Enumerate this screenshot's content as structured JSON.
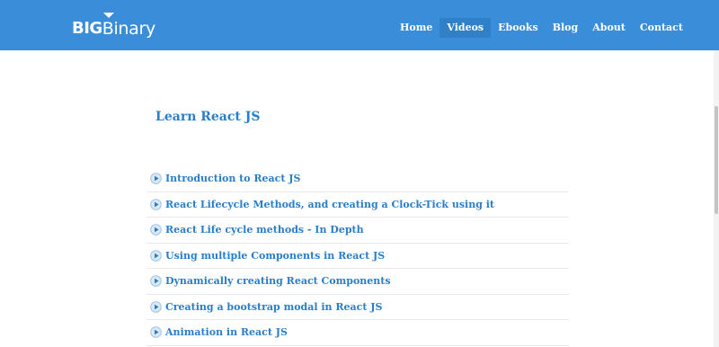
{
  "header": {
    "logo": {
      "big": "BIG",
      "binary": "Binary"
    },
    "nav": [
      {
        "label": "Home",
        "active": false
      },
      {
        "label": "Videos",
        "active": true
      },
      {
        "label": "Ebooks",
        "active": false
      },
      {
        "label": "Blog",
        "active": false
      },
      {
        "label": "About",
        "active": false
      },
      {
        "label": "Contact",
        "active": false
      }
    ]
  },
  "main": {
    "title": "Learn React JS",
    "videos": [
      {
        "title": "Introduction to React JS",
        "icon": "play-circle-icon"
      },
      {
        "title": "React Lifecycle Methods, and creating a Clock-Tick using it",
        "icon": "play-circle-icon"
      },
      {
        "title": "React Life cycle methods - In Depth",
        "icon": "play-circle-icon"
      },
      {
        "title": "Using multiple Components in React JS",
        "icon": "play-circle-icon"
      },
      {
        "title": "Dynamically creating React Components",
        "icon": "play-circle-icon"
      },
      {
        "title": "Creating a bootstrap modal in React JS",
        "icon": "play-circle-icon"
      },
      {
        "title": "Animation in React JS",
        "icon": "play-circle-icon"
      }
    ]
  },
  "colors": {
    "header_bg": "#3a8ed9",
    "nav_active_bg": "#2f80c7",
    "link": "#2a7ec9",
    "icon_ring": "#9cc3e6",
    "icon_fill": "#dbe9f5",
    "icon_triangle": "#2a7ec9",
    "divider": "#e6ebef"
  }
}
